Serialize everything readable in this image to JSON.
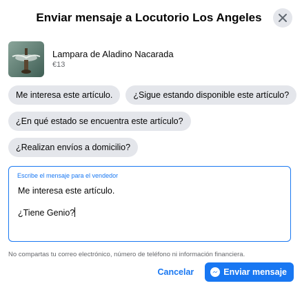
{
  "dialog": {
    "title": "Enviar mensaje a Locutorio Los Angeles",
    "close_icon": "close-icon"
  },
  "product": {
    "name": "Lampara de Aladino Nacarada",
    "price": "€13"
  },
  "suggestions": [
    "Me interesa este artículo.",
    "¿Sigue estando disponible este artículo?",
    "¿En qué estado se encuentra este artículo?",
    "¿Realizan envíos a domicilio?"
  ],
  "message": {
    "label": "Escribe el mensaje para el vendedor",
    "value": "Me interesa este artículo.\n\n¿Tiene Genio?"
  },
  "disclaimer": "No compartas tu correo electrónico, número de teléfono ni información financiera.",
  "footer": {
    "cancel_label": "Cancelar",
    "send_label": "Enviar mensaje",
    "send_icon": "messenger-icon"
  },
  "colors": {
    "accent": "#1877f2",
    "chip_bg": "#e4e6eb",
    "secondary_text": "#65676b"
  }
}
